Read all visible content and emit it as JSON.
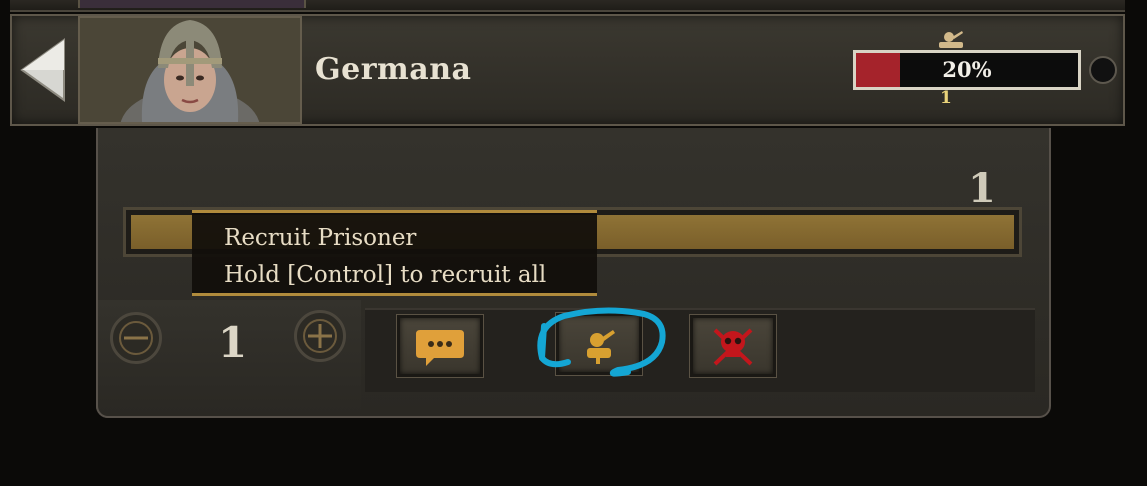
{
  "character": {
    "name": "Germana",
    "progress_text": "20%",
    "progress_value": 0.2,
    "count_below_bar": "1"
  },
  "slider": {
    "count": "1"
  },
  "tooltip": {
    "title": "Recruit Prisoner",
    "hint": "Hold [Control] to recruit all"
  },
  "quantity": {
    "value": "1"
  },
  "actions": [
    {
      "icon": "speech-bubble-icon"
    },
    {
      "icon": "recruit-icon"
    },
    {
      "icon": "skull-crossbones-icon"
    }
  ],
  "colors": {
    "progress_fill": "#a5232b",
    "accent_gold": "#c99a2a",
    "highlight_annotation": "#14a6d4",
    "skull_red": "#c3161c"
  }
}
